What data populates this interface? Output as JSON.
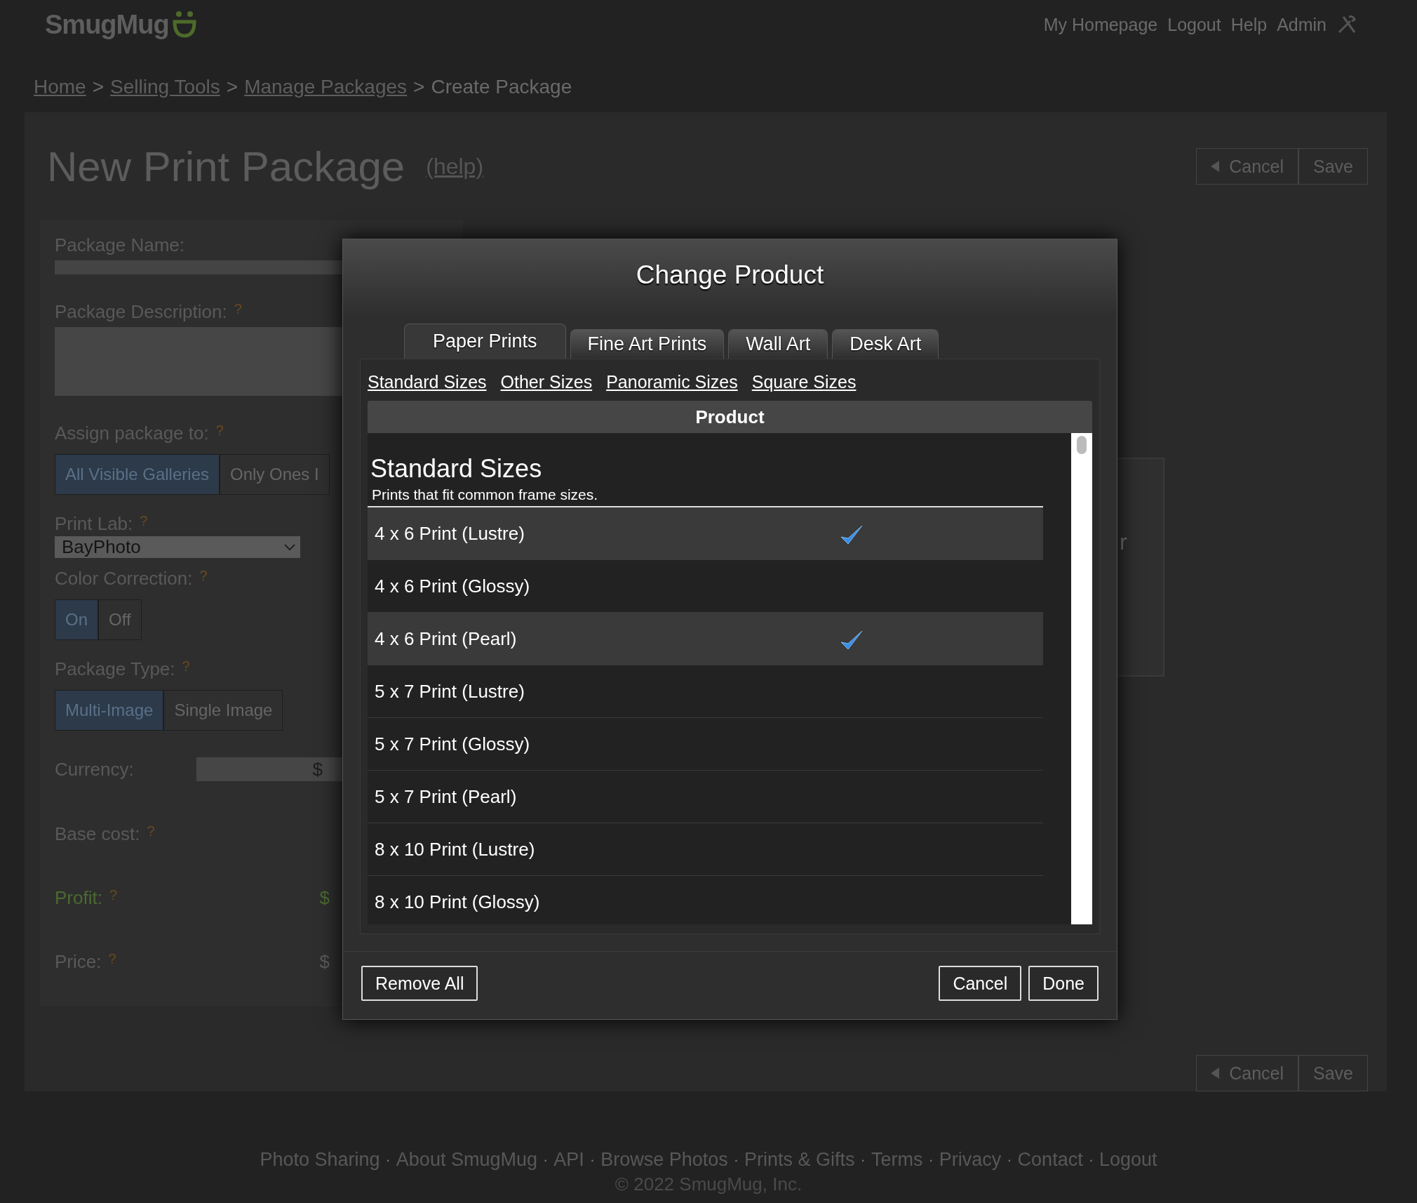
{
  "header": {
    "logo": "SmugMug",
    "nav": [
      "My Homepage",
      "Logout",
      "Help",
      "Admin"
    ]
  },
  "breadcrumb": {
    "links": [
      "Home",
      "Selling Tools",
      "Manage Packages"
    ],
    "separator": ">",
    "current": "Create Package"
  },
  "page": {
    "title": "New Print Package",
    "help_link": "(help)",
    "actions": {
      "cancel": "Cancel",
      "save": "Save"
    },
    "bottom_actions": {
      "cancel": "Cancel",
      "save": "Save"
    }
  },
  "form": {
    "fields": [
      {
        "kind": "input",
        "label": "Package Name:"
      },
      {
        "kind": "textarea",
        "label": "Package Description:",
        "help": true
      },
      {
        "kind": "segmented",
        "label": "Assign package to:",
        "help": true,
        "options": [
          {
            "label": "All Visible Galleries",
            "selected": true
          },
          {
            "label": "Only Ones I",
            "selected": false
          }
        ]
      },
      {
        "kind": "select",
        "label": "Print Lab:",
        "help": true,
        "value": "BayPhoto"
      },
      {
        "kind": "segmented",
        "label": "Color Correction:",
        "help": true,
        "options": [
          {
            "label": "On",
            "selected": true
          },
          {
            "label": "Off",
            "selected": false
          }
        ]
      },
      {
        "kind": "segmented",
        "label": "Package Type:",
        "help": true,
        "options": [
          {
            "label": "Multi-Image",
            "selected": true
          },
          {
            "label": "Single Image",
            "selected": false
          }
        ]
      },
      {
        "kind": "currency",
        "label": "Currency:",
        "value": "$"
      },
      {
        "kind": "amount",
        "label": "Base cost:",
        "help": true
      },
      {
        "kind": "profit",
        "label": "Profit:",
        "help": true,
        "value": "$"
      },
      {
        "kind": "amount",
        "label": "Price:",
        "help": true,
        "value": "$"
      }
    ],
    "help_mark": "?"
  },
  "side_box": {
    "text": "r"
  },
  "modal": {
    "title": "Change Product",
    "tabs": [
      {
        "label": "Paper Prints",
        "selected": true
      },
      {
        "label": "Fine Art Prints",
        "selected": false
      },
      {
        "label": "Wall Art",
        "selected": false
      },
      {
        "label": "Desk Art",
        "selected": false
      }
    ],
    "size_links": [
      "Standard Sizes",
      "Other Sizes",
      "Panoramic Sizes",
      "Square Sizes"
    ],
    "column": "Product",
    "section": {
      "title": "Standard Sizes",
      "subtitle": "Prints that fit common frame sizes."
    },
    "rows": [
      {
        "name": "4 x 6 Print (Lustre)",
        "selected": true
      },
      {
        "name": "4 x 6 Print (Glossy)",
        "selected": false
      },
      {
        "name": "4 x 6 Print (Pearl)",
        "selected": true
      },
      {
        "name": "5 x 7 Print (Lustre)",
        "selected": false
      },
      {
        "name": "5 x 7 Print (Glossy)",
        "selected": false
      },
      {
        "name": "5 x 7 Print (Pearl)",
        "selected": false
      },
      {
        "name": "8 x 10 Print (Lustre)",
        "selected": false
      },
      {
        "name": "8 x 10 Print (Glossy)",
        "selected": false
      }
    ],
    "buttons": {
      "remove_all": "Remove All",
      "cancel": "Cancel",
      "done": "Done"
    }
  },
  "footer": {
    "separator": "·",
    "links": [
      "Photo Sharing",
      "About SmugMug",
      "API",
      "Browse Photos",
      "Prints & Gifts",
      "Terms",
      "Privacy",
      "Contact",
      "Logout"
    ],
    "copyright": "© 2022 SmugMug, Inc."
  }
}
